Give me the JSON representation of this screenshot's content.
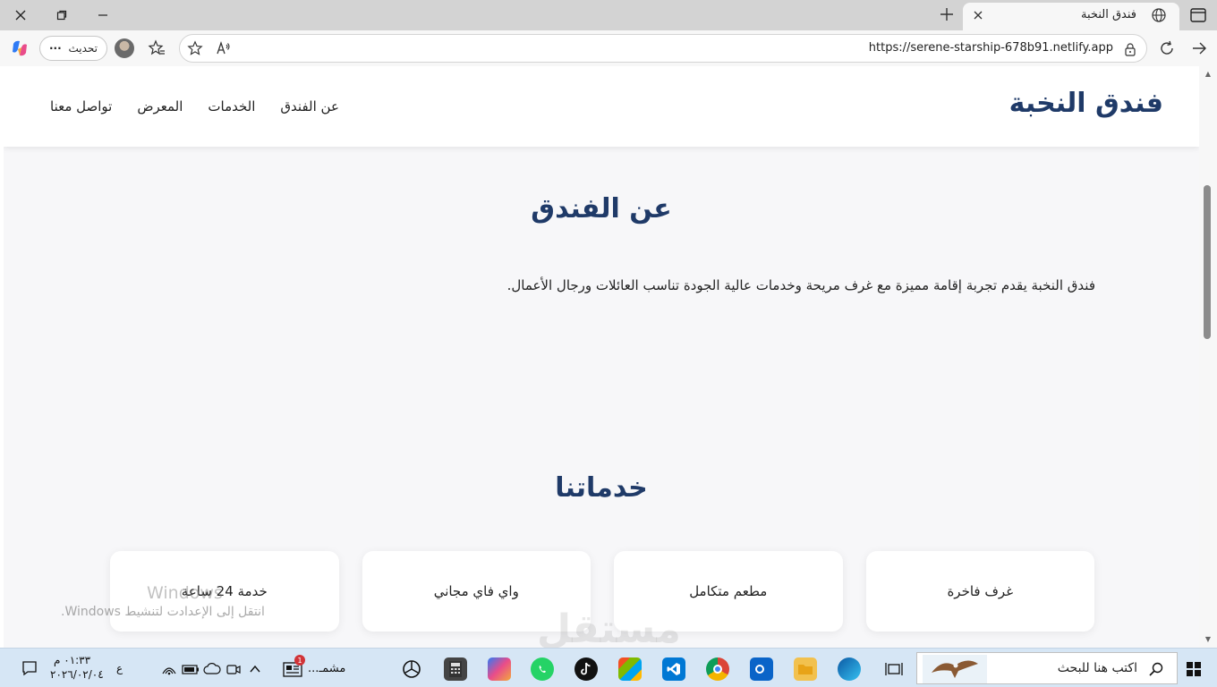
{
  "browser": {
    "tab_title": "فندق النخبة",
    "url": "https://serene-starship-678b91.netlify.app",
    "update_label": "تحديث",
    "more_label": "···"
  },
  "site": {
    "brand": "فندق النخبة",
    "nav": [
      "عن الفندق",
      "الخدمات",
      "المعرض",
      "تواصل معنا"
    ],
    "about": {
      "title": "عن الفندق",
      "text": "فندق النخبة يقدم تجربة إقامة مميزة مع غرف مريحة وخدمات عالية الجودة تناسب العائلات ورجال الأعمال."
    },
    "services": {
      "title": "خدماتنا",
      "items": [
        "غرف فاخرة",
        "مطعم متكامل",
        "واي فاي مجاني",
        "خدمة 24 ساعة"
      ]
    }
  },
  "overlay": {
    "windows_activation_line1": "Windows",
    "windows_activation_line2": "انتقل إلى الإعدادت لتنشيط Windows.",
    "watermark_brand": "مستقل"
  },
  "taskbar": {
    "search_placeholder": "اكتب هنا للبحث",
    "time": "٠١:٣٣ م",
    "date": "٢٠٢٦/٠٢/٠٤",
    "lang": "ع",
    "running_app_label": "مشمـ...",
    "notification_badge": "1"
  }
}
